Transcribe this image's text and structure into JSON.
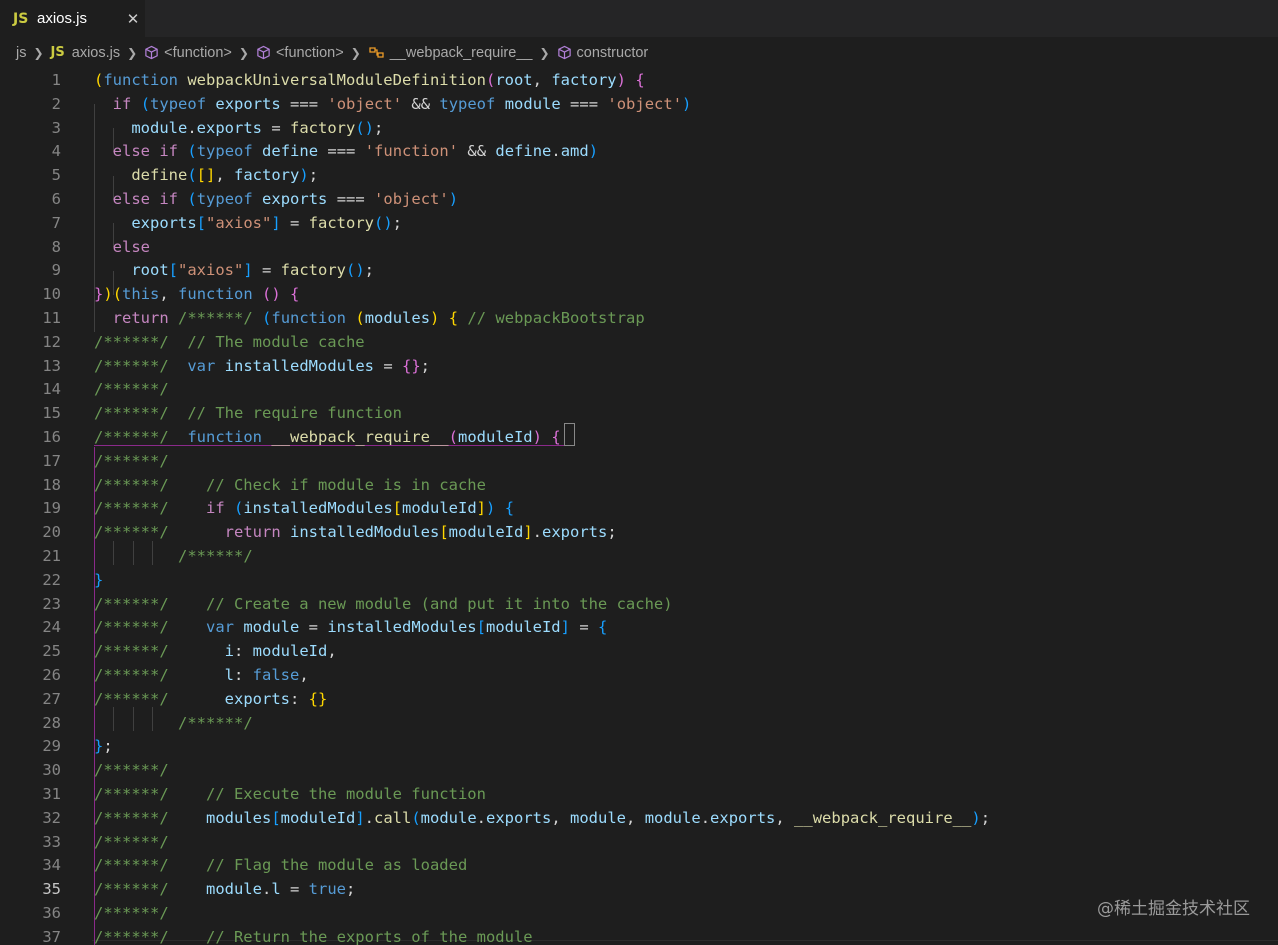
{
  "tab": {
    "icon": "JS",
    "title": "axios.js",
    "close": "✕"
  },
  "breadcrumb": {
    "root": "js",
    "file_icon": "JS",
    "file": "axios.js",
    "fn1": "<function>",
    "fn2": "<function>",
    "fn3": "__webpack_require__",
    "fn4": "constructor"
  },
  "editor": {
    "active_line": 35
  },
  "lines": [
    {
      "n": "1",
      "tokens": [
        [
          "(",
          "b1"
        ],
        [
          "function",
          "t-kw"
        ],
        [
          " ",
          ""
        ],
        [
          "webpackUniversalModuleDefinition",
          "t-fn"
        ],
        [
          "(",
          "b2"
        ],
        [
          "root",
          "t-var"
        ],
        [
          ", ",
          ""
        ],
        [
          "factory",
          "t-var"
        ],
        [
          ")",
          "b2"
        ],
        [
          " ",
          ""
        ],
        [
          "{",
          "b2"
        ]
      ]
    },
    {
      "n": "2",
      "tokens": [
        [
          "  ",
          ""
        ],
        [
          "if",
          "t-ctl"
        ],
        [
          " ",
          ""
        ],
        [
          "(",
          "b3"
        ],
        [
          "typeof",
          "t-kw"
        ],
        [
          " ",
          ""
        ],
        [
          "exports",
          "t-var"
        ],
        [
          " === ",
          ""
        ],
        [
          "'object'",
          "t-str"
        ],
        [
          " && ",
          ""
        ],
        [
          "typeof",
          "t-kw"
        ],
        [
          " ",
          ""
        ],
        [
          "module",
          "t-var"
        ],
        [
          " === ",
          ""
        ],
        [
          "'object'",
          "t-str"
        ],
        [
          ")",
          "b3"
        ]
      ]
    },
    {
      "n": "3",
      "tokens": [
        [
          "    ",
          ""
        ],
        [
          "module",
          "t-var"
        ],
        [
          ".",
          ""
        ],
        [
          "exports",
          "t-var"
        ],
        [
          " = ",
          ""
        ],
        [
          "factory",
          "t-fn"
        ],
        [
          "()",
          "b3"
        ],
        [
          ";",
          ""
        ]
      ]
    },
    {
      "n": "4",
      "tokens": [
        [
          "  ",
          ""
        ],
        [
          "else",
          "t-ctl"
        ],
        [
          " ",
          ""
        ],
        [
          "if",
          "t-ctl"
        ],
        [
          " ",
          ""
        ],
        [
          "(",
          "b3"
        ],
        [
          "typeof",
          "t-kw"
        ],
        [
          " ",
          ""
        ],
        [
          "define",
          "t-var"
        ],
        [
          " === ",
          ""
        ],
        [
          "'function'",
          "t-str"
        ],
        [
          " && ",
          ""
        ],
        [
          "define",
          "t-var"
        ],
        [
          ".",
          ""
        ],
        [
          "amd",
          "t-var"
        ],
        [
          ")",
          "b3"
        ]
      ]
    },
    {
      "n": "5",
      "tokens": [
        [
          "    ",
          ""
        ],
        [
          "define",
          "t-fn"
        ],
        [
          "(",
          "b3"
        ],
        [
          "[]",
          "b1"
        ],
        [
          ", ",
          ""
        ],
        [
          "factory",
          "t-var"
        ],
        [
          ")",
          "b3"
        ],
        [
          ";",
          ""
        ]
      ]
    },
    {
      "n": "6",
      "tokens": [
        [
          "  ",
          ""
        ],
        [
          "else",
          "t-ctl"
        ],
        [
          " ",
          ""
        ],
        [
          "if",
          "t-ctl"
        ],
        [
          " ",
          ""
        ],
        [
          "(",
          "b3"
        ],
        [
          "typeof",
          "t-kw"
        ],
        [
          " ",
          ""
        ],
        [
          "exports",
          "t-var"
        ],
        [
          " === ",
          ""
        ],
        [
          "'object'",
          "t-str"
        ],
        [
          ")",
          "b3"
        ]
      ]
    },
    {
      "n": "7",
      "tokens": [
        [
          "    ",
          ""
        ],
        [
          "exports",
          "t-var"
        ],
        [
          "[",
          "b3"
        ],
        [
          "\"axios\"",
          "t-str"
        ],
        [
          "]",
          "b3"
        ],
        [
          " = ",
          ""
        ],
        [
          "factory",
          "t-fn"
        ],
        [
          "()",
          "b3"
        ],
        [
          ";",
          ""
        ]
      ]
    },
    {
      "n": "8",
      "tokens": [
        [
          "  ",
          ""
        ],
        [
          "else",
          "t-ctl"
        ]
      ]
    },
    {
      "n": "9",
      "tokens": [
        [
          "    ",
          ""
        ],
        [
          "root",
          "t-var"
        ],
        [
          "[",
          "b3"
        ],
        [
          "\"axios\"",
          "t-str"
        ],
        [
          "]",
          "b3"
        ],
        [
          " = ",
          ""
        ],
        [
          "factory",
          "t-fn"
        ],
        [
          "()",
          "b3"
        ],
        [
          ";",
          ""
        ]
      ]
    },
    {
      "n": "10",
      "tokens": [
        [
          "}",
          "b2"
        ],
        [
          ")",
          "b1"
        ],
        [
          "(",
          "b1"
        ],
        [
          "this",
          "t-kw"
        ],
        [
          ", ",
          ""
        ],
        [
          "function",
          "t-kw"
        ],
        [
          " ",
          ""
        ],
        [
          "()",
          "b2"
        ],
        [
          " ",
          ""
        ],
        [
          "{",
          "b2"
        ]
      ]
    },
    {
      "n": "11",
      "tokens": [
        [
          "  ",
          ""
        ],
        [
          "return",
          "t-ctl"
        ],
        [
          " ",
          ""
        ],
        [
          "/******/",
          "t-cmt"
        ],
        [
          " ",
          ""
        ],
        [
          "(",
          "b3"
        ],
        [
          "function",
          "t-kw"
        ],
        [
          " ",
          ""
        ],
        [
          "(",
          "b1"
        ],
        [
          "modules",
          "t-var"
        ],
        [
          ")",
          "b1"
        ],
        [
          " ",
          ""
        ],
        [
          "{",
          "b1"
        ],
        [
          " ",
          ""
        ],
        [
          "// webpackBootstrap",
          "t-cmt"
        ]
      ]
    },
    {
      "n": "12",
      "tokens": [
        [
          "/******/",
          "t-cmt"
        ],
        [
          "  ",
          ""
        ],
        [
          "// The module cache",
          "t-cmt"
        ]
      ]
    },
    {
      "n": "13",
      "tokens": [
        [
          "/******/",
          "t-cmt"
        ],
        [
          "  ",
          ""
        ],
        [
          "var",
          "t-kw"
        ],
        [
          " ",
          ""
        ],
        [
          "installedModules",
          "t-var"
        ],
        [
          " = ",
          ""
        ],
        [
          "{}",
          "b2"
        ],
        [
          ";",
          ""
        ]
      ]
    },
    {
      "n": "14",
      "tokens": [
        [
          "/******/",
          "t-cmt"
        ]
      ]
    },
    {
      "n": "15",
      "tokens": [
        [
          "/******/",
          "t-cmt"
        ],
        [
          "  ",
          ""
        ],
        [
          "// The require function",
          "t-cmt"
        ]
      ]
    },
    {
      "n": "16",
      "tokens": [
        [
          "/******/",
          "t-cmt"
        ],
        [
          "  ",
          ""
        ],
        [
          "function",
          "t-kw"
        ],
        [
          " ",
          ""
        ],
        [
          "__webpack_require__",
          "t-fn"
        ],
        [
          "(",
          "b2"
        ],
        [
          "moduleId",
          "t-var"
        ],
        [
          ")",
          "b2"
        ],
        [
          " ",
          ""
        ],
        [
          "{",
          "b2"
        ]
      ]
    },
    {
      "n": "17",
      "tokens": [
        [
          "/******/",
          "t-cmt"
        ]
      ]
    },
    {
      "n": "18",
      "tokens": [
        [
          "/******/",
          "t-cmt"
        ],
        [
          "    ",
          ""
        ],
        [
          "// Check if module is in cache",
          "t-cmt"
        ]
      ]
    },
    {
      "n": "19",
      "tokens": [
        [
          "/******/",
          "t-cmt"
        ],
        [
          "    ",
          ""
        ],
        [
          "if",
          "t-ctl"
        ],
        [
          " ",
          ""
        ],
        [
          "(",
          "b3"
        ],
        [
          "installedModules",
          "t-var"
        ],
        [
          "[",
          "b1"
        ],
        [
          "moduleId",
          "t-var"
        ],
        [
          "]",
          "b1"
        ],
        [
          ")",
          "b3"
        ],
        [
          " ",
          ""
        ],
        [
          "{",
          "b3"
        ]
      ]
    },
    {
      "n": "20",
      "tokens": [
        [
          "/******/",
          "t-cmt"
        ],
        [
          "      ",
          ""
        ],
        [
          "return",
          "t-ctl"
        ],
        [
          " ",
          ""
        ],
        [
          "installedModules",
          "t-var"
        ],
        [
          "[",
          "b1"
        ],
        [
          "moduleId",
          "t-var"
        ],
        [
          "]",
          "b1"
        ],
        [
          ".",
          ""
        ],
        [
          "exports",
          "t-var"
        ],
        [
          ";",
          ""
        ]
      ]
    },
    {
      "n": "21",
      "tokens": [
        [
          "         ",
          ""
        ],
        [
          "/******/",
          "t-cmt"
        ]
      ]
    },
    {
      "n": "22",
      "tokens": [
        [
          "}",
          "b3"
        ]
      ]
    },
    {
      "n": "23",
      "tokens": [
        [
          "/******/",
          "t-cmt"
        ],
        [
          "    ",
          ""
        ],
        [
          "// Create a new module (and put it into the cache)",
          "t-cmt"
        ]
      ]
    },
    {
      "n": "24",
      "tokens": [
        [
          "/******/",
          "t-cmt"
        ],
        [
          "    ",
          ""
        ],
        [
          "var",
          "t-kw"
        ],
        [
          " ",
          ""
        ],
        [
          "module",
          "t-var"
        ],
        [
          " = ",
          ""
        ],
        [
          "installedModules",
          "t-var"
        ],
        [
          "[",
          "b3"
        ],
        [
          "moduleId",
          "t-var"
        ],
        [
          "]",
          "b3"
        ],
        [
          " = ",
          ""
        ],
        [
          "{",
          "b3"
        ]
      ]
    },
    {
      "n": "25",
      "tokens": [
        [
          "/******/",
          "t-cmt"
        ],
        [
          "      ",
          ""
        ],
        [
          "i",
          "t-var"
        ],
        [
          ": ",
          ""
        ],
        [
          "moduleId",
          "t-var"
        ],
        [
          ",",
          ""
        ]
      ]
    },
    {
      "n": "26",
      "tokens": [
        [
          "/******/",
          "t-cmt"
        ],
        [
          "      ",
          ""
        ],
        [
          "l",
          "t-var"
        ],
        [
          ": ",
          ""
        ],
        [
          "false",
          "t-kw"
        ],
        [
          ",",
          ""
        ]
      ]
    },
    {
      "n": "27",
      "tokens": [
        [
          "/******/",
          "t-cmt"
        ],
        [
          "      ",
          ""
        ],
        [
          "exports",
          "t-var"
        ],
        [
          ": ",
          ""
        ],
        [
          "{}",
          "b1"
        ]
      ]
    },
    {
      "n": "28",
      "tokens": [
        [
          "         ",
          ""
        ],
        [
          "/******/",
          "t-cmt"
        ]
      ]
    },
    {
      "n": "29",
      "tokens": [
        [
          "}",
          "b3"
        ],
        [
          ";",
          ""
        ]
      ]
    },
    {
      "n": "30",
      "tokens": [
        [
          "/******/",
          "t-cmt"
        ]
      ]
    },
    {
      "n": "31",
      "tokens": [
        [
          "/******/",
          "t-cmt"
        ],
        [
          "    ",
          ""
        ],
        [
          "// Execute the module function",
          "t-cmt"
        ]
      ]
    },
    {
      "n": "32",
      "tokens": [
        [
          "/******/",
          "t-cmt"
        ],
        [
          "    ",
          ""
        ],
        [
          "modules",
          "t-var"
        ],
        [
          "[",
          "b3"
        ],
        [
          "moduleId",
          "t-var"
        ],
        [
          "]",
          "b3"
        ],
        [
          ".",
          ""
        ],
        [
          "call",
          "t-fn"
        ],
        [
          "(",
          "b3"
        ],
        [
          "module",
          "t-var"
        ],
        [
          ".",
          ""
        ],
        [
          "exports",
          "t-var"
        ],
        [
          ", ",
          ""
        ],
        [
          "module",
          "t-var"
        ],
        [
          ", ",
          ""
        ],
        [
          "module",
          "t-var"
        ],
        [
          ".",
          ""
        ],
        [
          "exports",
          "t-var"
        ],
        [
          ", ",
          ""
        ],
        [
          "__webpack_require__",
          "t-fn"
        ],
        [
          ")",
          "b3"
        ],
        [
          ";",
          ""
        ]
      ]
    },
    {
      "n": "33",
      "tokens": [
        [
          "/******/",
          "t-cmt"
        ]
      ]
    },
    {
      "n": "34",
      "tokens": [
        [
          "/******/",
          "t-cmt"
        ],
        [
          "    ",
          ""
        ],
        [
          "// Flag the module as loaded",
          "t-cmt"
        ]
      ]
    },
    {
      "n": "35",
      "tokens": [
        [
          "/******/",
          "t-cmt"
        ],
        [
          "    ",
          ""
        ],
        [
          "module",
          "t-var"
        ],
        [
          ".",
          ""
        ],
        [
          "l",
          "t-var"
        ],
        [
          " = ",
          ""
        ],
        [
          "true",
          "t-kw"
        ],
        [
          ";",
          ""
        ]
      ]
    },
    {
      "n": "36",
      "tokens": [
        [
          "/******/",
          "t-cmt"
        ]
      ]
    },
    {
      "n": "37",
      "tokens": [
        [
          "/******/",
          "t-cmt"
        ],
        [
          "    ",
          ""
        ],
        [
          "// Return the exports of the module",
          "t-cmt"
        ]
      ]
    }
  ],
  "watermark": "@稀土掘金技术社区"
}
